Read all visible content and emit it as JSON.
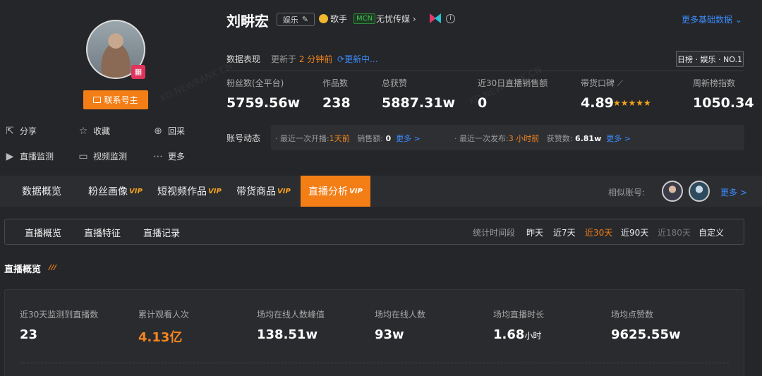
{
  "profile": {
    "name": "刘畊宏",
    "category_tag": "娱乐",
    "role": "歌手",
    "mcn_badge": "MCN",
    "mcn_name": "无忧传媒",
    "more_basic": "更多基础数据",
    "contact_btn": "联系号主",
    "actions": [
      "分享",
      "收藏",
      "回采",
      "直播监测",
      "视频监测",
      "更多"
    ]
  },
  "performance": {
    "label": "数据表现",
    "updated_prefix": "更新于",
    "updated_time": "2 分钟前",
    "updating": "更新中...",
    "rank_badge": "日榜 · 娱乐 · NO.1",
    "stats": [
      {
        "label": "粉丝数(全平台)",
        "value": "5759.56w"
      },
      {
        "label": "作品数",
        "value": "238"
      },
      {
        "label": "总获赞",
        "value": "5887.31w"
      },
      {
        "label": "近30日直播销售额",
        "value": "0"
      },
      {
        "label": "带货口碑",
        "value": "4.89"
      },
      {
        "label": "周新榜指数",
        "value": "1050.34"
      }
    ],
    "stars": "★★★★★"
  },
  "dynamics": {
    "label": "账号动态",
    "live_prefix": "最近一次开播:",
    "live_time": "1天前",
    "sales_label": "销售额:",
    "sales_value": "0",
    "more1": "更多 >",
    "post_prefix": "最近一次发布:",
    "post_time": "3 小时前",
    "likes_label": "获赞数:",
    "likes_value": "6.81w",
    "more2": "更多 >"
  },
  "nav": {
    "tabs": [
      {
        "label": "数据概览",
        "vip": ""
      },
      {
        "label": "粉丝画像",
        "vip": "VIP"
      },
      {
        "label": "短视频作品",
        "vip": "VIP"
      },
      {
        "label": "带货商品",
        "vip": "VIP"
      },
      {
        "label": "直播分析",
        "vip": "VIP"
      }
    ],
    "similar_label": "相似账号:",
    "more": "更多 >"
  },
  "subnav": {
    "tabs": [
      "直播概览",
      "直播特征",
      "直播记录"
    ],
    "period_label": "统计时间段",
    "periods": [
      "昨天",
      "近7天",
      "近30天",
      "近90天",
      "近180天",
      "自定义"
    ],
    "active_period": "近30天"
  },
  "overview": {
    "title": "直播概览",
    "metrics": [
      {
        "label": "近30天监测到直播数",
        "value": "23",
        "unit": ""
      },
      {
        "label": "累计观看人次",
        "value": "4.13亿",
        "unit": ""
      },
      {
        "label": "场均在线人数峰值",
        "value": "138.51w",
        "unit": ""
      },
      {
        "label": "场均在线人数",
        "value": "93w",
        "unit": ""
      },
      {
        "label": "场均直播时长",
        "value": "1.68",
        "unit": "小时"
      },
      {
        "label": "场均点赞数",
        "value": "9625.55w",
        "unit": ""
      }
    ]
  },
  "watermark": "XD.NEWRANK.CN",
  "colors": {
    "accent": "#f37e16",
    "link": "#3b8cff",
    "bg": "#252629"
  }
}
